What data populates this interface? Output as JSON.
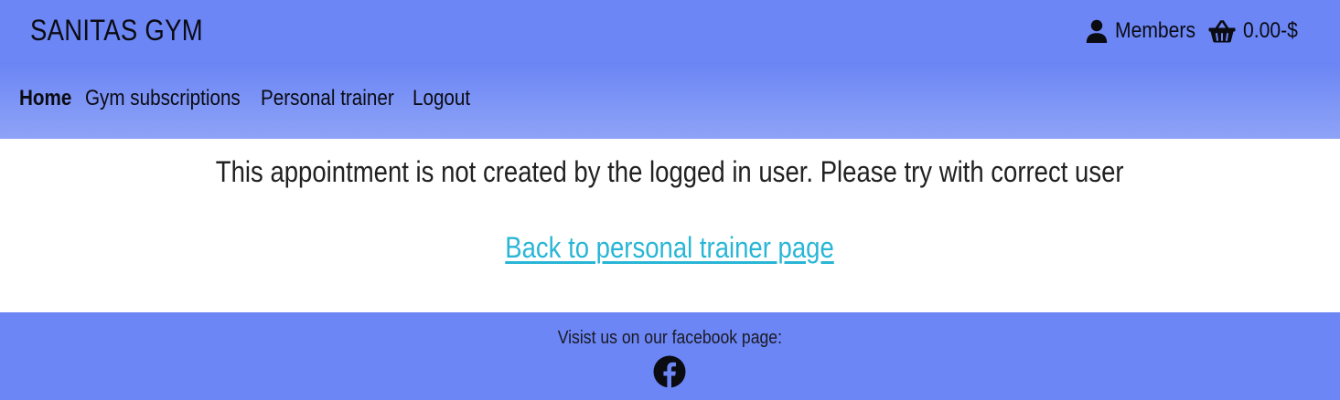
{
  "header": {
    "brand": "SANITAS GYM",
    "members_label": "Members",
    "members_icon": "user-icon",
    "basket_total": "0.00-$",
    "basket_icon": "basket-icon"
  },
  "nav": {
    "items": [
      {
        "label": "Home",
        "active": true
      },
      {
        "label": "Gym subscriptions",
        "active": false
      },
      {
        "label": "Personal trainer",
        "active": false
      },
      {
        "label": "Logout",
        "active": false
      }
    ]
  },
  "main": {
    "message": "This appointment is not created by the logged in user. Please try with correct user",
    "back_link": "Back to personal trainer page"
  },
  "footer": {
    "text": "Visist us on our facebook page:",
    "facebook_icon": "facebook-icon"
  },
  "colors": {
    "header_bg": "#6c86f5",
    "link": "#29b6d6",
    "text": "#212121"
  }
}
